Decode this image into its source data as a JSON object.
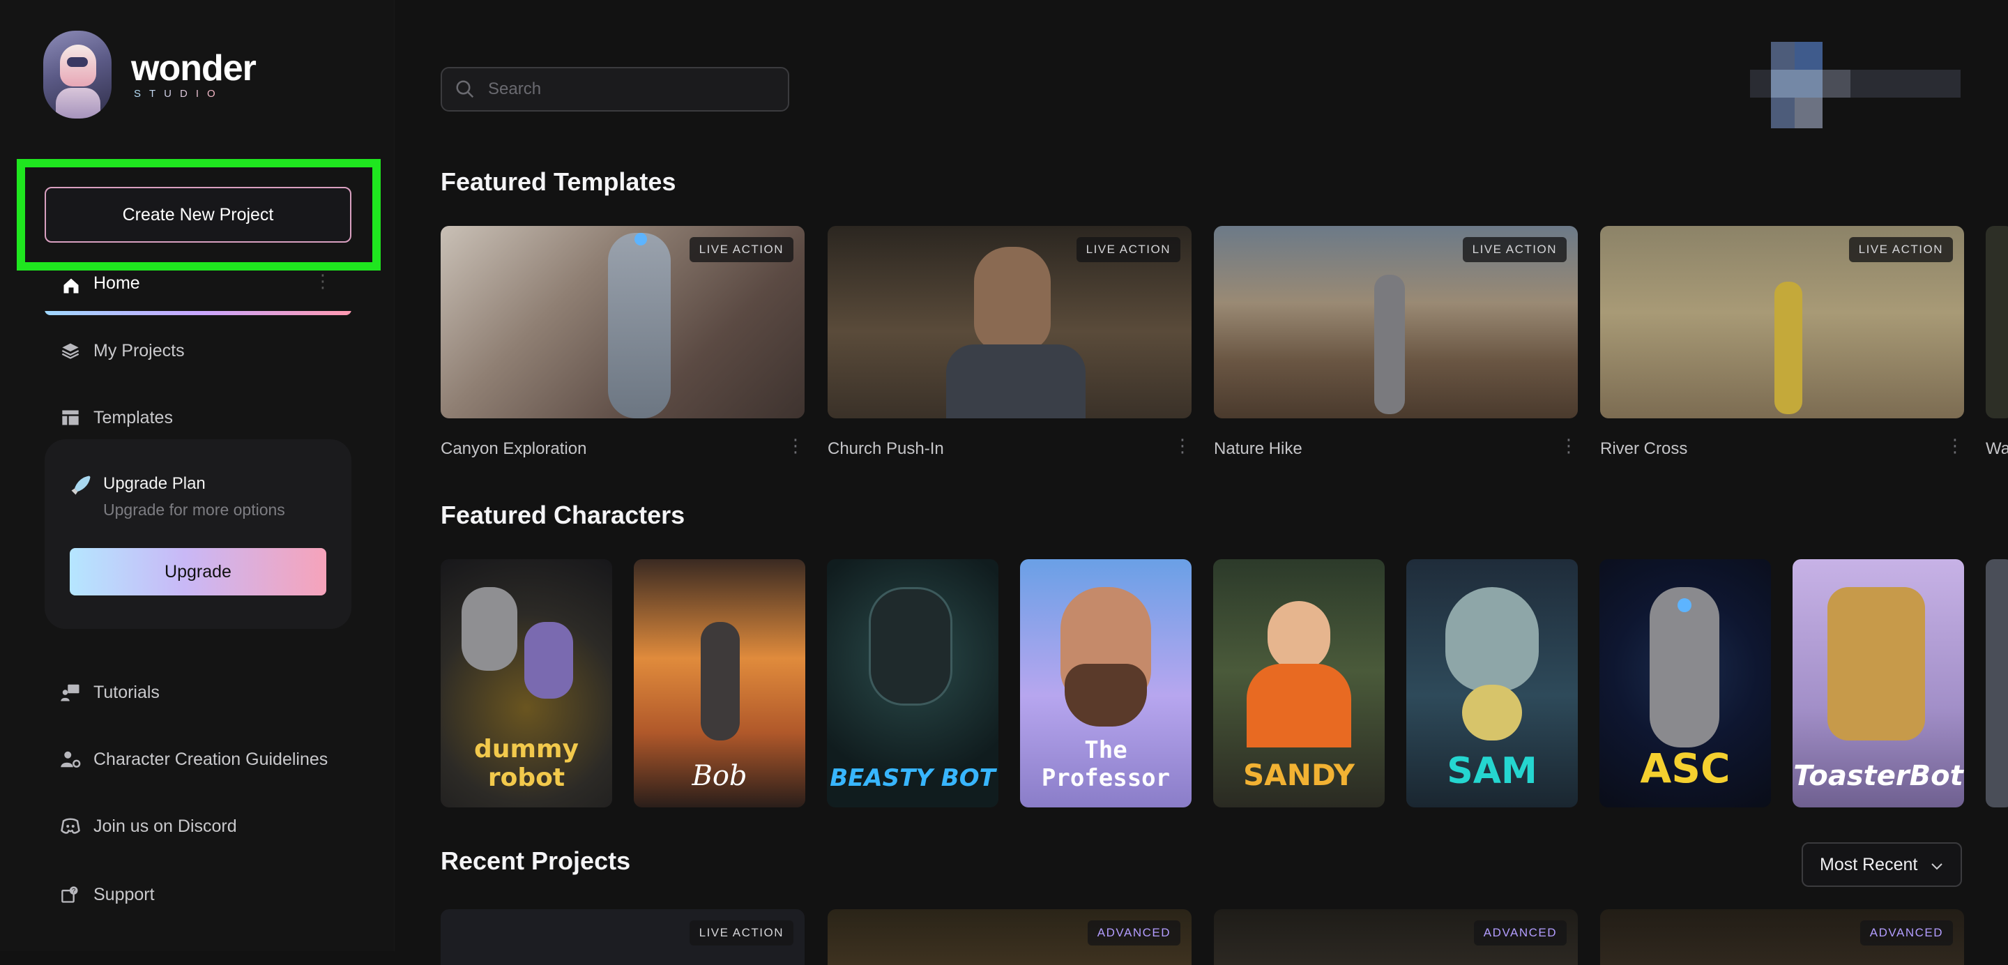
{
  "brand": {
    "word": "wonder",
    "sub": "STUDIO"
  },
  "sidebar": {
    "create_label": "Create New Project",
    "nav": [
      {
        "label": "Home",
        "icon": "home-icon"
      },
      {
        "label": "My Projects",
        "icon": "layers-icon"
      },
      {
        "label": "Templates",
        "icon": "templates-icon"
      }
    ],
    "upgrade": {
      "title": "Upgrade Plan",
      "subtitle": "Upgrade for more options",
      "button": "Upgrade"
    },
    "links": [
      {
        "label": "Tutorials",
        "icon": "tutorial-icon"
      },
      {
        "label": "Character Creation Guidelines",
        "icon": "user-gear-icon"
      },
      {
        "label": "Join us on Discord",
        "icon": "discord-icon"
      },
      {
        "label": "Support",
        "icon": "support-icon"
      }
    ]
  },
  "search": {
    "placeholder": "Search"
  },
  "featured_templates": {
    "title": "Featured Templates",
    "items": [
      {
        "name": "Canyon Exploration",
        "badge": "LIVE ACTION"
      },
      {
        "name": "Church Push-In",
        "badge": "LIVE ACTION"
      },
      {
        "name": "Nature Hike",
        "badge": "LIVE ACTION"
      },
      {
        "name": "River Cross",
        "badge": "LIVE ACTION"
      },
      {
        "name": "Wa"
      }
    ]
  },
  "featured_characters": {
    "title": "Featured Characters",
    "items": [
      {
        "label": "dummy robot",
        "color": "#f2c94c"
      },
      {
        "label": "Bob",
        "color": "#ffffff"
      },
      {
        "label": "BEASTY BOT",
        "color": "#38b6ff"
      },
      {
        "label": "The Professor",
        "color": "#ffffff"
      },
      {
        "label": "SANDY",
        "color": "#f2b233"
      },
      {
        "label": "SAM",
        "color": "#25d6d0"
      },
      {
        "label": "ASC",
        "color": "#f5d02f"
      },
      {
        "label": "ToasterBot",
        "color": "#ffffff"
      }
    ]
  },
  "recent_projects": {
    "title": "Recent Projects",
    "sort": "Most Recent",
    "badges": [
      "LIVE ACTION",
      "ADVANCED",
      "ADVANCED",
      "ADVANCED"
    ]
  },
  "colors": {
    "accent_green": "#1fe61f",
    "advanced_badge": "#b39dff"
  }
}
